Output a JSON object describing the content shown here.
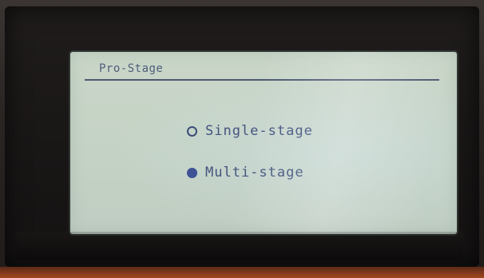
{
  "screen": {
    "title": "Pro-Stage",
    "options": [
      {
        "label": "Single-stage",
        "selected": false
      },
      {
        "label": "Multi-stage",
        "selected": true
      }
    ]
  },
  "colors": {
    "lcd_background": "#c9d6c8",
    "text": "#44547e",
    "title_text": "#4f5d7a",
    "rule": "#4d5a70",
    "radio_selected": "#3e5294"
  }
}
